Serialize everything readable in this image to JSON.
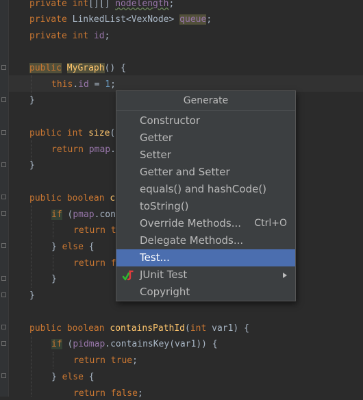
{
  "editor": {
    "lines": [
      {
        "id": "l1",
        "text": "private int[][] nodelength;"
      },
      {
        "id": "l2",
        "text": "private LinkedList<VexNode> queue;"
      },
      {
        "id": "l3",
        "text": "private int id;"
      },
      {
        "id": "l4",
        "text": "public MyGraph() {"
      },
      {
        "id": "l5",
        "text": "this.id = 1;"
      },
      {
        "id": "l6",
        "text": "}"
      },
      {
        "id": "l7",
        "text": "public int size("
      },
      {
        "id": "l8",
        "text": "return pmap."
      },
      {
        "id": "l9",
        "text": "}"
      },
      {
        "id": "l10",
        "text": "public boolean c"
      },
      {
        "id": "l11",
        "text": "if (pmap.con"
      },
      {
        "id": "l12",
        "text": "return t"
      },
      {
        "id": "l13",
        "text": "} else {"
      },
      {
        "id": "l14",
        "text": "return f"
      },
      {
        "id": "l15",
        "text": "}"
      },
      {
        "id": "l16",
        "text": "}"
      },
      {
        "id": "l17",
        "text": "public boolean containsPathId(int var1) {"
      },
      {
        "id": "l18",
        "text": "if (pidmap.containsKey(var1)) {"
      },
      {
        "id": "l19",
        "text": "return true;"
      },
      {
        "id": "l20",
        "text": "} else {"
      },
      {
        "id": "l21",
        "text": "return false;"
      }
    ]
  },
  "popup": {
    "title": "Generate",
    "items": [
      {
        "label": "Constructor",
        "shortcut": ""
      },
      {
        "label": "Getter",
        "shortcut": ""
      },
      {
        "label": "Setter",
        "shortcut": ""
      },
      {
        "label": "Getter and Setter",
        "shortcut": ""
      },
      {
        "label": "equals() and hashCode()",
        "shortcut": ""
      },
      {
        "label": "toString()",
        "shortcut": ""
      },
      {
        "label": "Override Methods...",
        "shortcut": "Ctrl+O"
      },
      {
        "label": "Delegate Methods...",
        "shortcut": ""
      },
      {
        "label": "Test...",
        "shortcut": "",
        "selected": true
      },
      {
        "label": "JUnit Test",
        "shortcut": "",
        "icon": "junit-icon",
        "submenu": true
      },
      {
        "label": "Copyright",
        "shortcut": ""
      }
    ]
  },
  "colors": {
    "background": "#2b2b2b",
    "keyword": "#cc7832",
    "field": "#9876aa",
    "number": "#6897bb",
    "method": "#ffc66d",
    "selection": "#4b6eaf"
  }
}
